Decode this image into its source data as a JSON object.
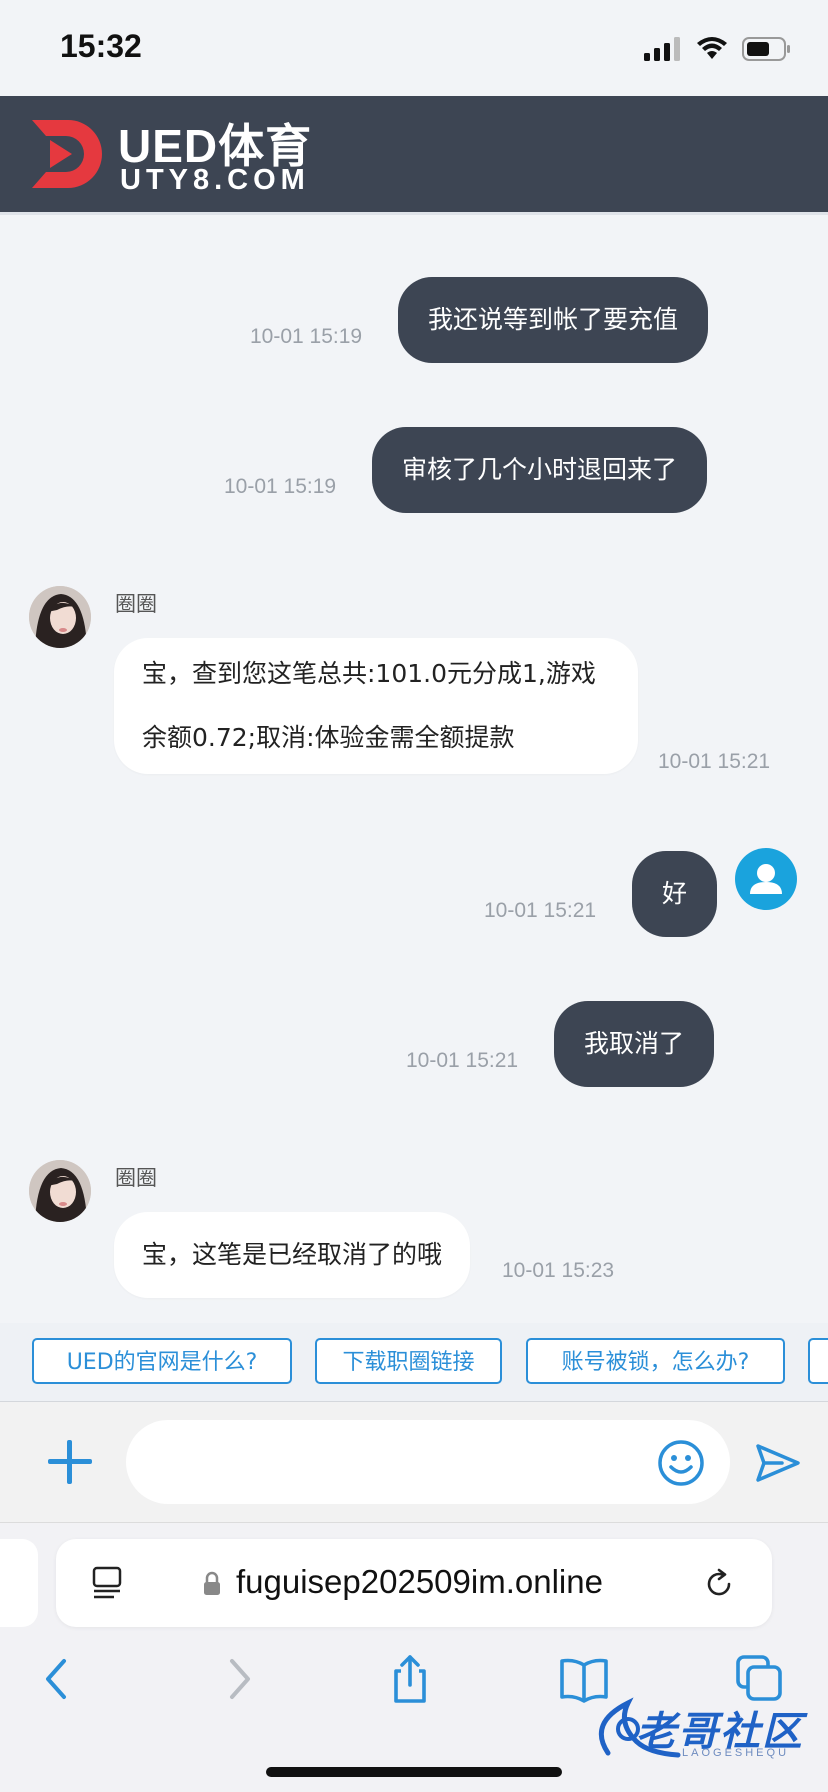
{
  "status_bar": {
    "time": "15:32"
  },
  "header": {
    "title": "UED体育",
    "subtitle": "UTY8.COM"
  },
  "messages": [
    {
      "from": "user",
      "text": "我还说等到帐了要充值",
      "time": "10-01 15:19"
    },
    {
      "from": "user",
      "text": "审核了几个小时退回来了",
      "time": "10-01 15:19"
    },
    {
      "from": "agent",
      "name": "圈圈",
      "lines": [
        "宝，查到您这笔总共:101.0元分成1,游戏",
        "余额0.72;取消:体验金需全额提款"
      ],
      "time": "10-01 15:21"
    },
    {
      "from": "user",
      "text": "好",
      "time": "10-01 15:21"
    },
    {
      "from": "user",
      "text": "我取消了",
      "time": "10-01 15:21"
    },
    {
      "from": "agent",
      "name": "圈圈",
      "lines": [
        "宝，这笔是已经取消了的哦"
      ],
      "time": "10-01 15:23"
    }
  ],
  "quick_replies": [
    "UED的官网是什么?",
    "下载职圈链接",
    "账号被锁，怎么办?"
  ],
  "input": {
    "placeholder": ""
  },
  "browser": {
    "url": "fuguisep202509im.online"
  },
  "watermark": {
    "text": "老哥社区",
    "sub": "LAOGESHEQU"
  },
  "colors": {
    "header": "#3d4553",
    "outgoing_bubble": "#3d4553",
    "accent": "#2b8fd8",
    "logo_red": "#e5393f"
  }
}
